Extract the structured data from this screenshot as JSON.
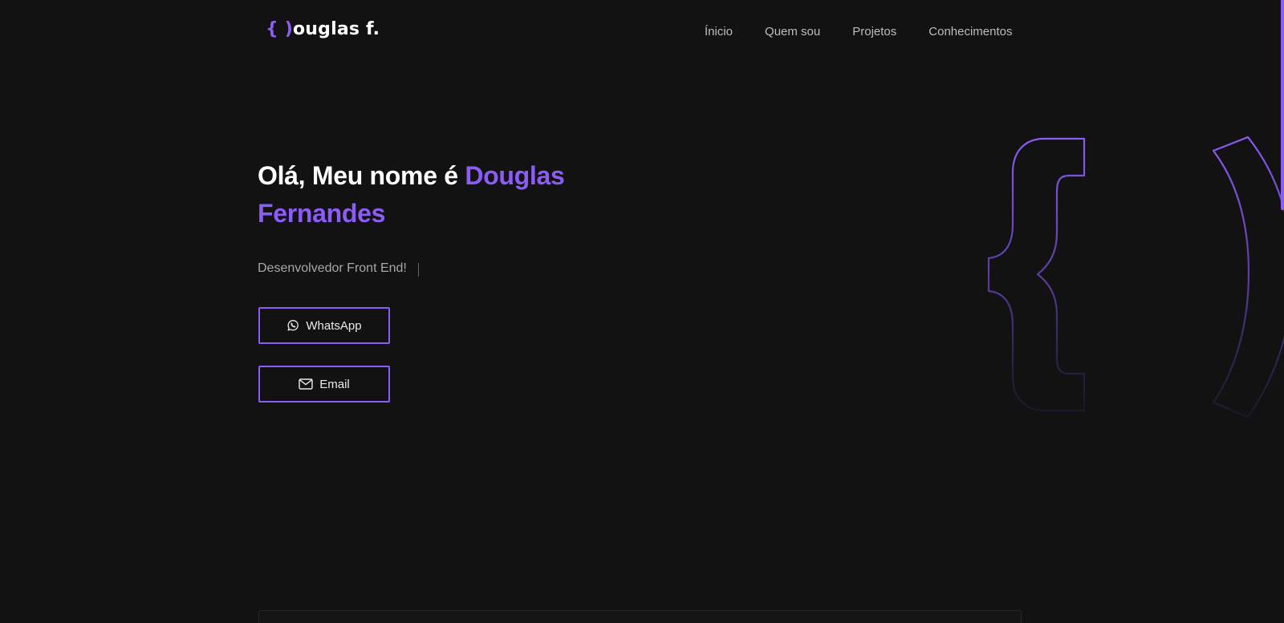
{
  "header": {
    "logo_brace": "{ )",
    "logo_text": "ouglas f.",
    "nav": [
      {
        "label": "Ínicio"
      },
      {
        "label": "Quem sou"
      },
      {
        "label": "Projetos"
      },
      {
        "label": "Conhecimentos"
      }
    ]
  },
  "hero": {
    "greeting": "Olá, Meu nome é ",
    "name": "Douglas Fernandes",
    "subtitle": "Desenvolvedor Front End!",
    "buttons": {
      "whatsapp_label": "WhatsApp",
      "whatsapp_icon": "whatsapp-icon",
      "email_label": "Email",
      "email_icon": "mail-icon"
    }
  },
  "colors": {
    "background": "#121212",
    "accent": "#8b5cf6",
    "text": "#ffffff",
    "muted": "#a8a8a8"
  }
}
